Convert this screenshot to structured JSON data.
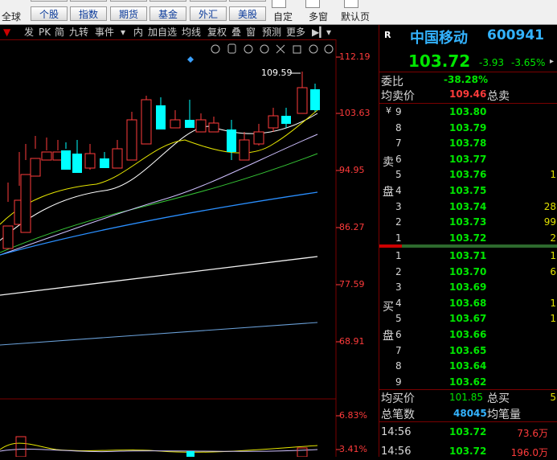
{
  "top": {
    "left_label": "全球",
    "nav": [
      {
        "label": "个股",
        "key": "gegu"
      },
      {
        "label": "指数",
        "key": "zhishu"
      },
      {
        "label": "期货",
        "key": "qihuo"
      },
      {
        "label": "基金",
        "key": "jijin"
      },
      {
        "label": "外汇",
        "key": "waihui"
      },
      {
        "label": "美股",
        "key": "meigu"
      }
    ],
    "right": [
      "自定",
      "多窗",
      "默认页"
    ]
  },
  "toolbar": [
    "发",
    "PK",
    "简",
    "九转",
    "事件",
    "内",
    "加自选",
    "均线",
    "复权",
    "叠",
    "窗",
    "预测",
    "更多"
  ],
  "price_axis": {
    "labels": [
      "112.19",
      "103.63",
      "94.95",
      "86.27",
      "77.59",
      "68.91"
    ],
    "pct_labels": [
      "6.83%",
      "3.41%"
    ]
  },
  "annotation": {
    "high": "109.59"
  },
  "stock": {
    "badge": "R",
    "name": "中国移动",
    "code": "600941",
    "price": "103.72",
    "change": "-3.93",
    "change_pct": "-3.65%"
  },
  "order_book": {
    "weibi_label": "委比",
    "weibi_value": "-38.28%",
    "avg_sell_label": "均卖价",
    "avg_sell_value": "109.46",
    "total_sell_label": "总卖",
    "sell_side_label_1": "卖",
    "sell_side_label_2": "盘",
    "buy_side_label_1": "买",
    "buy_side_label_2": "盘",
    "sell": [
      {
        "level": "9",
        "price": "103.80",
        "vol": ""
      },
      {
        "level": "8",
        "price": "103.79",
        "vol": ""
      },
      {
        "level": "7",
        "price": "103.78",
        "vol": ""
      },
      {
        "level": "6",
        "price": "103.77",
        "vol": ""
      },
      {
        "level": "5",
        "price": "103.76",
        "vol": "1"
      },
      {
        "level": "4",
        "price": "103.75",
        "vol": ""
      },
      {
        "level": "3",
        "price": "103.74",
        "vol": "28"
      },
      {
        "level": "2",
        "price": "103.73",
        "vol": "99"
      },
      {
        "level": "1",
        "price": "103.72",
        "vol": "2"
      }
    ],
    "buy": [
      {
        "level": "1",
        "price": "103.71",
        "vol": "1"
      },
      {
        "level": "2",
        "price": "103.70",
        "vol": "6"
      },
      {
        "level": "3",
        "price": "103.69",
        "vol": ""
      },
      {
        "level": "4",
        "price": "103.68",
        "vol": "1"
      },
      {
        "level": "5",
        "price": "103.67",
        "vol": "1"
      },
      {
        "level": "6",
        "price": "103.66",
        "vol": ""
      },
      {
        "level": "7",
        "price": "103.65",
        "vol": ""
      },
      {
        "level": "8",
        "price": "103.64",
        "vol": ""
      },
      {
        "level": "9",
        "price": "103.62",
        "vol": ""
      }
    ],
    "avg_buy_label": "均买价",
    "avg_buy_value": "101.85",
    "total_buy_label": "总买",
    "total_buy_value": "5",
    "total_trades_label": "总笔数",
    "total_trades_value": "48045",
    "avg_trade_label": "均笔量"
  },
  "trades": [
    {
      "time": "14:56",
      "price": "103.72",
      "amount": "73.6万"
    },
    {
      "time": "14:56",
      "price": "103.72",
      "amount": "196.0万"
    }
  ],
  "colors": {
    "up": "#ff3b3b",
    "down": "#00ffff",
    "green": "#00e600",
    "yellow": "#e0e000"
  }
}
